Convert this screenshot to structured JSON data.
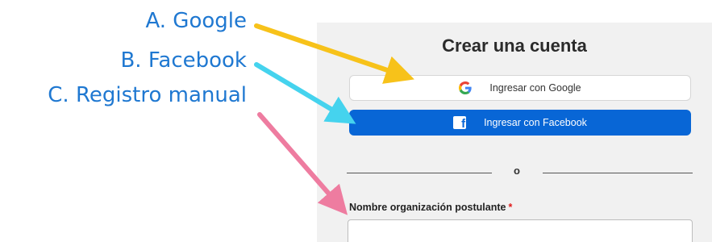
{
  "annotations": {
    "google": "A. Google",
    "facebook": "B. Facebook",
    "manual": "C. Registro manual"
  },
  "form": {
    "title": "Crear una cuenta",
    "google_button": "Ingresar con Google",
    "facebook_button": "Ingresar con Facebook",
    "facebook_icon_glyph": "f",
    "divider_text": "o",
    "org_name_label": "Nombre organización postulante",
    "required_marker": "*",
    "org_name_value": ""
  },
  "colors": {
    "annotation_text": "#1f78d1",
    "arrow_google": "#f7c21a",
    "arrow_facebook": "#45d3ee",
    "arrow_manual": "#ee7ca0",
    "facebook_blue": "#0866d6",
    "required_red": "#e01b1b"
  }
}
